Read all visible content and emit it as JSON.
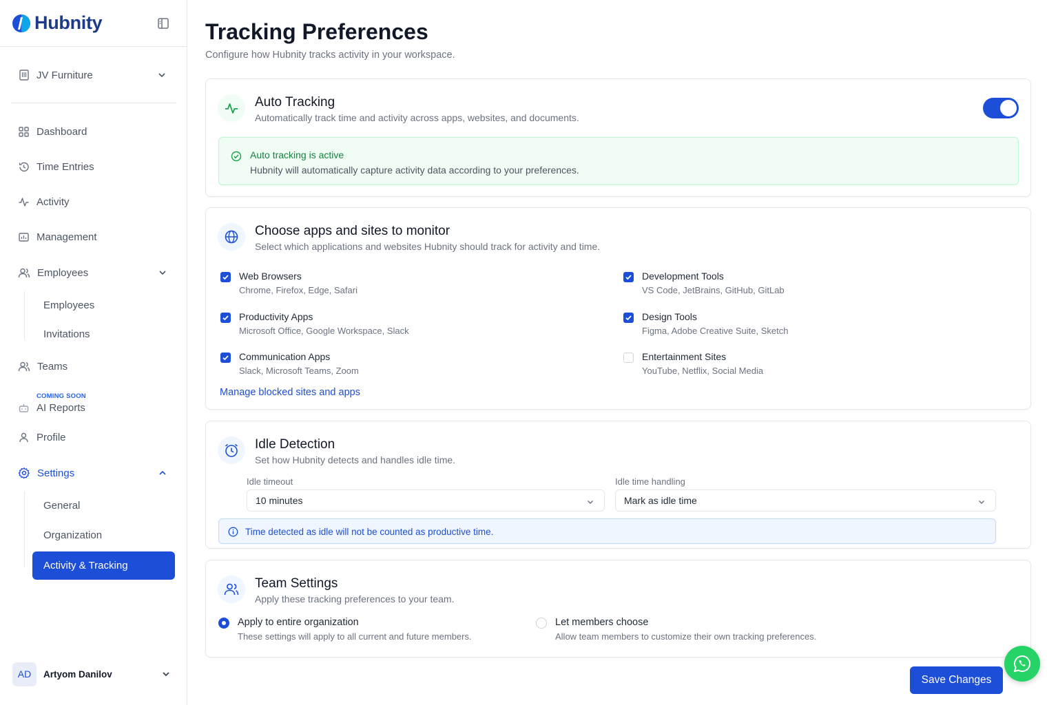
{
  "brand": {
    "name": "Hubnity",
    "accent": "#1d4ed8"
  },
  "workspace": {
    "name": "JV Furniture"
  },
  "nav": {
    "dashboard": "Dashboard",
    "time_entries": "Time Entries",
    "activity": "Activity",
    "management": "Management",
    "employees": "Employees",
    "employees_sub": [
      "Employees",
      "Invitations"
    ],
    "teams": "Teams",
    "ai_reports_badge": "COMING SOON",
    "ai_reports": "AI Reports",
    "profile": "Profile",
    "settings": "Settings",
    "settings_sub": [
      "General",
      "Organization",
      "Activity & Tracking"
    ]
  },
  "user": {
    "initials": "AD",
    "name": "Artyom Danilov"
  },
  "page": {
    "title": "Tracking Preferences",
    "subtitle": "Configure how Hubnity tracks activity in your workspace."
  },
  "auto_tracking": {
    "title": "Auto Tracking",
    "subtitle": "Automatically track time and activity across apps, websites, and documents.",
    "enabled": true,
    "status_title": "Auto tracking is active",
    "status_text": "Hubnity will automatically capture activity data according to your preferences."
  },
  "monitor": {
    "title": "Choose apps and sites to monitor",
    "subtitle": "Select which applications and websites Hubnity should track for activity and time.",
    "items": [
      {
        "label": "Web Browsers",
        "desc": "Chrome, Firefox, Edge, Safari",
        "checked": true
      },
      {
        "label": "Development Tools",
        "desc": "VS Code, JetBrains, GitHub, GitLab",
        "checked": true
      },
      {
        "label": "Productivity Apps",
        "desc": "Microsoft Office, Google Workspace, Slack",
        "checked": true
      },
      {
        "label": "Design Tools",
        "desc": "Figma, Adobe Creative Suite, Sketch",
        "checked": true
      },
      {
        "label": "Communication Apps",
        "desc": "Slack, Microsoft Teams, Zoom",
        "checked": true
      },
      {
        "label": "Entertainment Sites",
        "desc": "YouTube, Netflix, Social Media",
        "checked": false
      }
    ],
    "manage_link": "Manage blocked sites and apps"
  },
  "idle": {
    "title": "Idle Detection",
    "subtitle": "Set how Hubnity detects and handles idle time.",
    "timeout_label": "Idle timeout",
    "timeout_value": "10 minutes",
    "handling_label": "Idle time handling",
    "handling_value": "Mark as idle time",
    "info": "Time detected as idle will not be counted as productive time."
  },
  "team": {
    "title": "Team Settings",
    "subtitle": "Apply these tracking preferences to your team.",
    "options": [
      {
        "label": "Apply to entire organization",
        "desc": "These settings will apply to all current and future members.",
        "selected": true
      },
      {
        "label": "Let members choose",
        "desc": "Allow team members to customize their own tracking preferences.",
        "selected": false
      }
    ]
  },
  "actions": {
    "save": "Save Changes"
  }
}
